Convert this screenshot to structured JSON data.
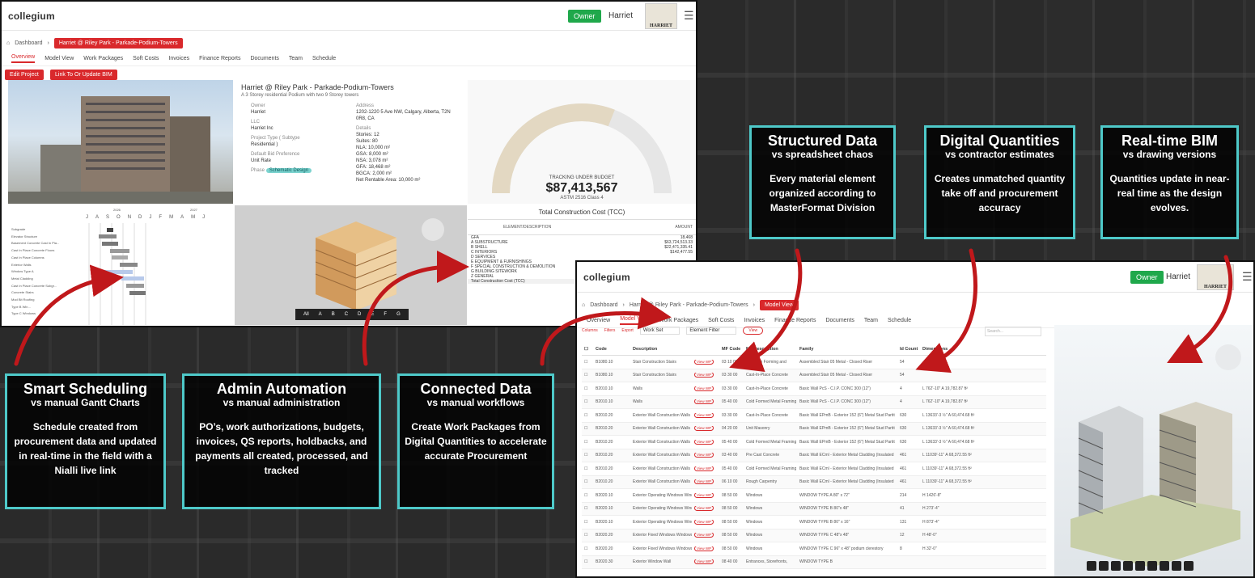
{
  "screen1": {
    "app": "collegium",
    "role": "Owner",
    "user": "Harriet",
    "brand": "HARRIET",
    "breadcrumbs": [
      "Dashboard",
      "Harriet @ Riley Park - Parkade-Podium-Towers"
    ],
    "tabs": [
      "Overview",
      "Model View",
      "Work Packages",
      "Soft Costs",
      "Invoices",
      "Finance Reports",
      "Documents",
      "Team",
      "Schedule"
    ],
    "buttons": [
      "Edit Project",
      "Link To Or Update BIM"
    ],
    "project": {
      "title": "Harriet @ Riley Park - Parkade-Podium-Towers",
      "subtitle": "A 3 Storey residential Podium with two 9 Storey towers",
      "owner_label": "Owner",
      "owner": "Harriet",
      "llc_label": "LLC",
      "llc": "Harriet Inc",
      "type_label": "Project Type ( Subtype",
      "type": "Residential )",
      "bid_label": "Default Bid Preference",
      "bid": "Unit Rate",
      "phase_label": "Phase",
      "phase": "Schematic Design",
      "address_label": "Address",
      "address": "1202-1220 5 Ave NW, Calgary, Alberta, T2N 0R8, CA",
      "details_label": "Details",
      "details": [
        "Stories: 12",
        "Suites: 80",
        "NLA: 10,000 m²",
        "GSA: 8,000 m²",
        "NSA: 3,078 m²",
        "GFA: 18,468 m²",
        "BGCA: 2,000 m²",
        "Net Rentable Area: 10,000 m²"
      ]
    },
    "budget": {
      "label": "TRACKING UNDER BUDGET",
      "amount": "$87,413,567",
      "basis": "ASTM 2516 Class 4",
      "progress": 0.62
    },
    "gantt": {
      "years": [
        "2026",
        "2027"
      ],
      "months": [
        "J",
        "A",
        "S",
        "O",
        "N",
        "D",
        "J",
        "F",
        "M",
        "A",
        "M",
        "J"
      ],
      "rows": [
        "Subgrade",
        "Elevator Structure",
        "Basement Concrete Cast In Pla...",
        "Cast In Place Concrete Floors",
        "Cast In Place Columns",
        "Exterior Walls",
        "Window Type A",
        "Metal Cladding",
        "Cast In Place Concrete Subgr...",
        "Concrete Stairs",
        "Mod Bit Roofing",
        "Type B Win...",
        "Type C Windows"
      ]
    },
    "bim_levels": [
      "All",
      "A",
      "B",
      "C",
      "D",
      "E",
      "F",
      "G"
    ],
    "tcc": {
      "title": "Total Construction Cost (TCC)",
      "col1": "ELEMENT/DESCRIPTION",
      "col2": "AMOUNT",
      "rows": [
        [
          "GFA",
          "18,468"
        ],
        [
          "A SUBSTRUCTURE",
          "$63,724,513.33"
        ],
        [
          "B SHELL",
          "$22,471,335.41"
        ],
        [
          "C INTERIORS",
          "$142,477.55"
        ],
        [
          "D SERVICES",
          ""
        ],
        [
          "E EQUIPMENT & FURNISHINGS",
          ""
        ],
        [
          "F SPECIAL CONSTRUCTION & DEMOLITION",
          ""
        ],
        [
          "G BUILDING SITEWORK",
          ""
        ],
        [
          "Z GENERAL",
          ""
        ],
        [
          "Total Construction Cost (TCC)",
          ""
        ]
      ]
    }
  },
  "screen2": {
    "app": "collegium",
    "role": "Owner",
    "user": "Harriet",
    "brand": "HARRIET",
    "breadcrumbs": [
      "Dashboard",
      "Harriet @ Riley Park - Parkade-Podium-Towers",
      "Model View"
    ],
    "tabs": [
      "Overview",
      "Model View",
      "Work Packages",
      "Soft Costs",
      "Invoices",
      "Finance Reports",
      "Documents",
      "Team",
      "Schedule"
    ],
    "toolbar": [
      "Columns",
      "Filters",
      "Export",
      "Work Set",
      "Element Filter",
      "View"
    ],
    "search_placeholder": "Search...",
    "columns": [
      "Code",
      "Description",
      "",
      "MF Code",
      "MF Description",
      "Family",
      "Id Count",
      "Dimensions"
    ],
    "rows": [
      [
        "B1080.10",
        "Stair Construction Stairs",
        "View WP",
        "03 10 00",
        "Concrete Forming and",
        "Assembled Stair 05 Metal - Closed Riser",
        "54",
        ""
      ],
      [
        "B1080.10",
        "Stair Construction Stairs",
        "View WP",
        "03 30 00",
        "Cast-In-Place Concrete",
        "Assembled Stair 05 Metal - Closed Riser",
        "54",
        ""
      ],
      [
        "B2010.10",
        "Walls",
        "View WP",
        "03 30 00",
        "Cast-In-Place Concrete",
        "Basic Wall PcS - C.I.P. CONC 300 (12\")",
        "4",
        "L 762'-10\"  A 19,782.87 ft²"
      ],
      [
        "B2010.10",
        "Walls",
        "View WP",
        "05 40 00",
        "Cold Formed Metal Framing",
        "Basic Wall PcS - C.I.P. CONC 300 (12\")",
        "4",
        "L 762'-10\"  A 19,782.87 ft²"
      ],
      [
        "B2010.20",
        "Exterior Wall Construction Walls",
        "View WP",
        "03 30 00",
        "Cast-In-Place Concrete",
        "Basic Wall EPmB - Exterior 152 (6\") Metal Stud Partit",
        "630",
        "L 13633'-3 ½\"  A 60,474.68 ft²"
      ],
      [
        "B2010.20",
        "Exterior Wall Construction Walls",
        "View WP",
        "04 20 00",
        "Unit Masonry",
        "Basic Wall EPmB - Exterior 152 (6\") Metal Stud Partit",
        "630",
        "L 13633'-3 ½\"  A 60,474.68 ft²"
      ],
      [
        "B2010.20",
        "Exterior Wall Construction Walls",
        "View WP",
        "05 40 00",
        "Cold Formed Metal Framing",
        "Basic Wall EPmB - Exterior 152 (6\") Metal Stud Partit",
        "630",
        "L 13633'-3 ½\"  A 60,474.68 ft²"
      ],
      [
        "B2010.20",
        "Exterior Wall Construction Walls",
        "View WP",
        "03 40 00",
        "Pre Cast Concrete",
        "Basic Wall ECml - Exterior Metal Cladding (Insulated",
        "461",
        "L 11039'-11\"  A 68,372.55 ft²"
      ],
      [
        "B2010.20",
        "Exterior Wall Construction Walls",
        "View WP",
        "05 40 00",
        "Cold Formed Metal Framing",
        "Basic Wall ECml - Exterior Metal Cladding (Insulated",
        "461",
        "L 11039'-11\"  A 68,372.55 ft²"
      ],
      [
        "B2010.20",
        "Exterior Wall Construction Walls",
        "View WP",
        "06 10 00",
        "Rough Carpentry",
        "Basic Wall ECml - Exterior Metal Cladding (Insulated",
        "461",
        "L 11039'-11\"  A 68,372.55 ft²"
      ],
      [
        "B2020.10",
        "Exterior Operating Windows Windows",
        "View WP",
        "08 50 00",
        "Windows",
        "WINDOW TYPE A 80\" x 72\"",
        "214",
        "H 1426'-8\""
      ],
      [
        "B2020.10",
        "Exterior Operating Windows Windows",
        "View WP",
        "08 50 00",
        "Windows",
        "WINDOW TYPE B 80\"x 48\"",
        "41",
        "H 273'-4\""
      ],
      [
        "B2020.10",
        "Exterior Operating Windows Windows",
        "View WP",
        "08 50 00",
        "Windows",
        "WINDOW TYPE B 80\" x 16\"",
        "131",
        "H 873'-4\""
      ],
      [
        "B2020.20",
        "Exterior Fixed Windows Windows",
        "View WP",
        "08 50 00",
        "Windows",
        "WINDOW TYPE C 48\"x 48\"",
        "12",
        "H 48'-0\""
      ],
      [
        "B2020.20",
        "Exterior Fixed Windows Windows",
        "View WP",
        "08 50 00",
        "Windows",
        "WINDOW TYPE C 96\" x 48\" podium clerestory",
        "8",
        "H 32'-0\""
      ],
      [
        "B2020.30",
        "Exterior Window Wall",
        "View WP",
        "08 40 00",
        "Entrances, Storefronts,",
        "WINDOW TYPE B",
        "",
        ""
      ]
    ]
  },
  "cards": [
    {
      "title": "Structured Data",
      "vs": "vs spreadsheet chaos",
      "body": "Every material element organized according to MasterFormat Division"
    },
    {
      "title": "Digital Quantities",
      "vs": "vs contractor estimates",
      "body": "Creates unmatched quantity take off and procurement accuracy"
    },
    {
      "title": "Real-time BIM",
      "vs": "vs drawing versions",
      "body": "Quantities update in near-real time as the design evolves."
    },
    {
      "title": "Smart Scheduling",
      "vs": "vs manual Gantt Charts",
      "body": "Schedule created from procurement data and updated in real-time in the field with a Nialli live link"
    },
    {
      "title": "Admin Automation",
      "vs": "vs manual administration",
      "body": "PO’s, work authorizations, budgets, invoices, QS reports, holdbacks, and payments all created, processed, and tracked"
    },
    {
      "title": "Connected Data",
      "vs": "vs manual workflows",
      "body": "Create Work Packages from Digital Quantities to accelerate accurate Procurement"
    }
  ],
  "colors": {
    "accent": "#d9292c",
    "card_border": "#4ec9c9",
    "owner_badge": "#1fa84b",
    "arrow": "#c0181b"
  },
  "icons": [
    "home-icon",
    "menu-icon",
    "overview-icon",
    "model-icon",
    "package-icon",
    "search-icon",
    "invoice-icon",
    "finance-icon",
    "documents-icon",
    "team-icon",
    "schedule-icon",
    "info-icon",
    "checkbox-icon",
    "sort-icon"
  ]
}
